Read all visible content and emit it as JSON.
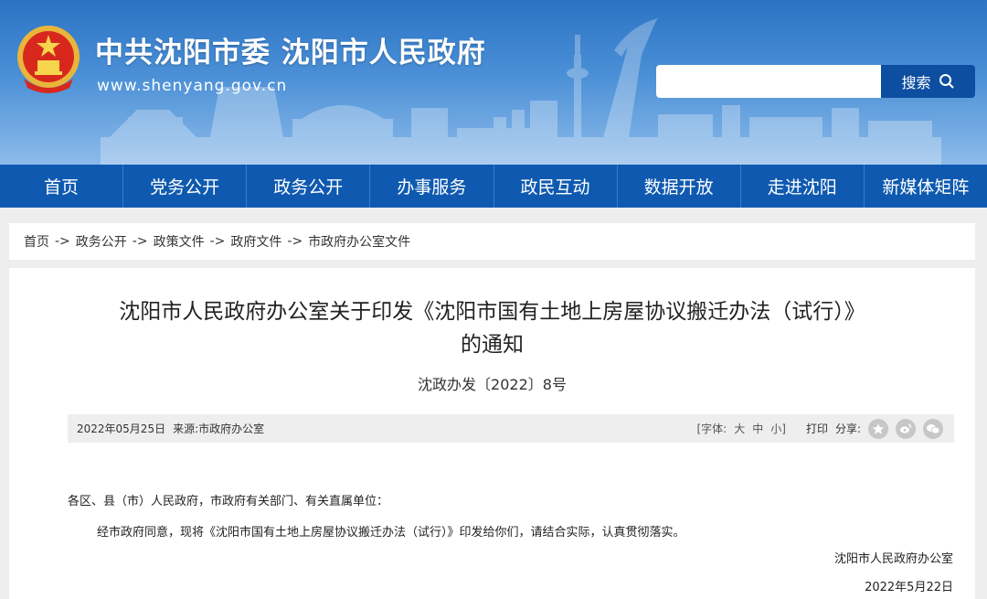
{
  "header": {
    "title": "中共沈阳市委  沈阳市人民政府",
    "url": "www.shenyang.gov.cn",
    "search_placeholder": "",
    "search_label": "搜索"
  },
  "nav": [
    "首页",
    "党务公开",
    "政务公开",
    "办事服务",
    "政民互动",
    "数据开放",
    "走进沈阳",
    "新媒体矩阵"
  ],
  "breadcrumb": [
    "首页",
    "政务公开",
    "政策文件",
    "政府文件",
    "市政府办公室文件"
  ],
  "breadcrumb_sep": "->",
  "article": {
    "title_line1": "沈阳市人民政府办公室关于印发《沈阳市国有土地上房屋协议搬迁办法（试行）》",
    "title_line2": "的通知",
    "doc_no": "沈政办发〔2022〕8号",
    "meta_date": "2022年05月25日",
    "meta_source_label": "来源:",
    "meta_source": "市政府办公室",
    "font_label": "[字体:",
    "font_large": "大",
    "font_mid": "中",
    "font_small": "小]",
    "print_label": "打印",
    "share_label": "分享:",
    "salutation": "各区、县（市）人民政府，市政府有关部门、有关直属单位：",
    "paragraph": "经市政府同意，现将《沈阳市国有土地上房屋协议搬迁办法（试行）》印发给你们，请结合实际，认真贯彻落实。",
    "signer": "沈阳市人民政府办公室",
    "sign_date": "2022年5月22日"
  },
  "colors": {
    "nav_bg": "#0f5ab0",
    "search_btn": "#0e4ea0",
    "header_top": "#2b73c4"
  }
}
